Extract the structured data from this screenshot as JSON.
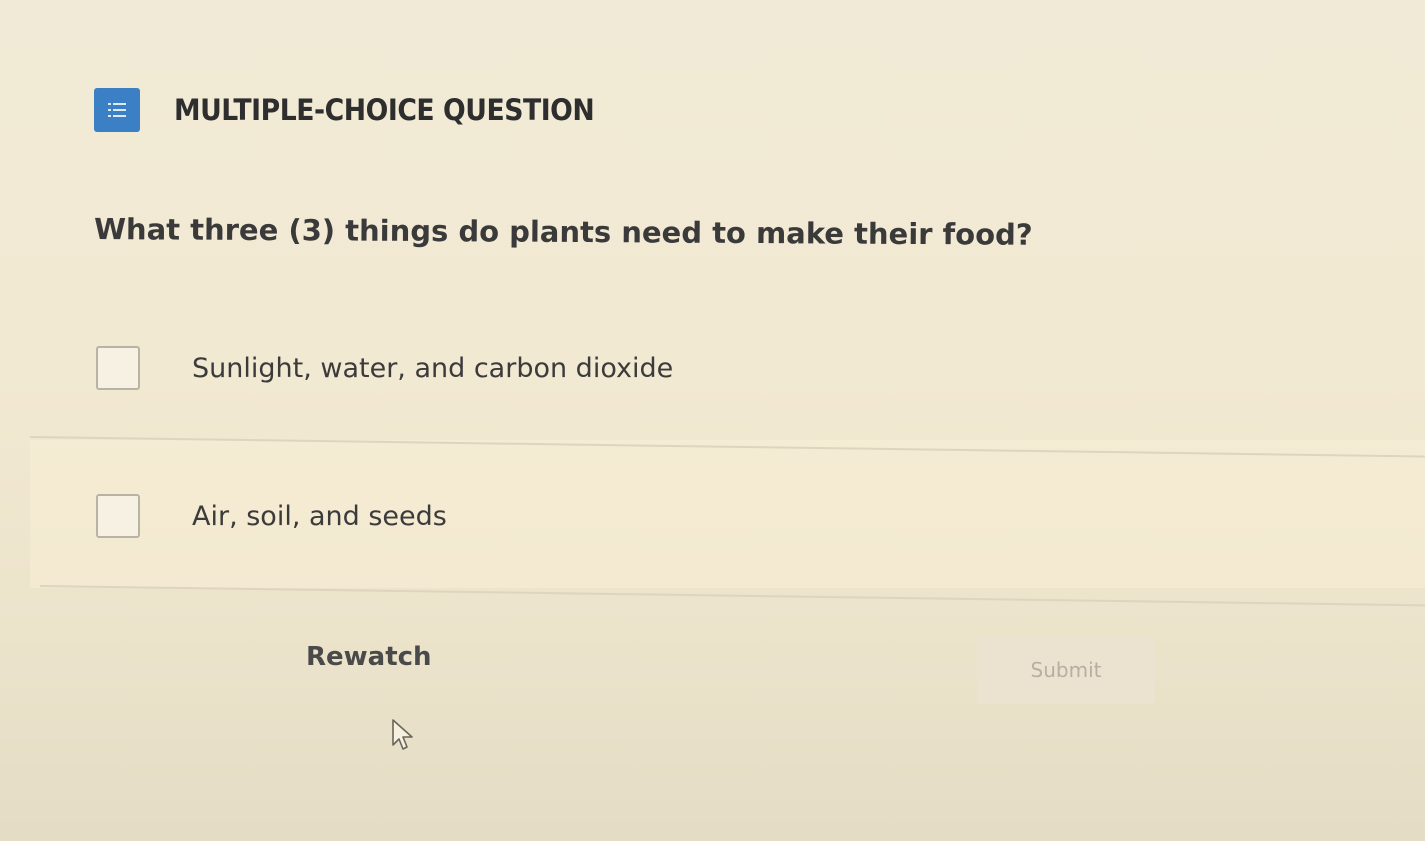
{
  "question": {
    "type_label": "MULTIPLE-CHOICE QUESTION",
    "type_icon": "list-icon",
    "text": "What three (3) things do plants need to make their food?"
  },
  "options": [
    {
      "label": "Sunlight, water, and carbon dioxide",
      "checked": false
    },
    {
      "label": "Air, soil, and seeds",
      "checked": false
    }
  ],
  "actions": {
    "rewatch_label": "Rewatch",
    "submit_label": "Submit",
    "submit_enabled": false
  },
  "colors": {
    "icon_bg": "#3b7fc4",
    "background": "#f1ead6"
  }
}
